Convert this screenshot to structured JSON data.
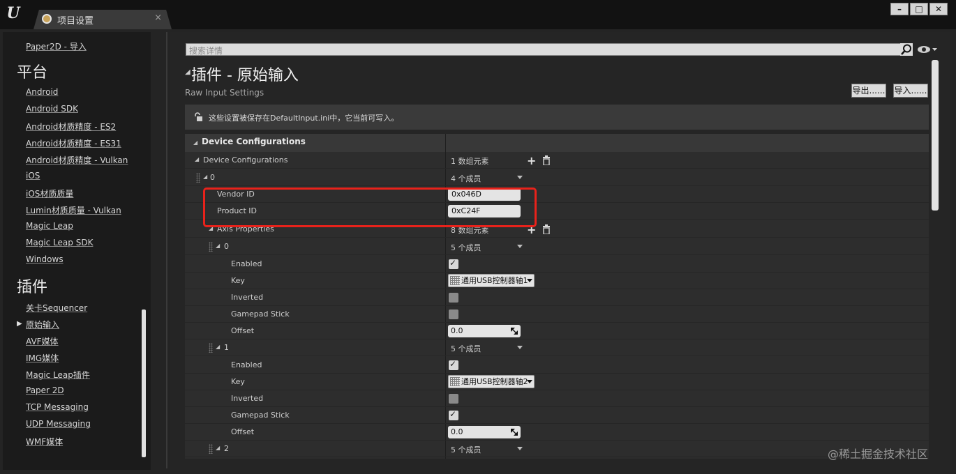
{
  "window": {
    "tab_label": "项目设置",
    "tab_close": "×",
    "logo_text": "U",
    "btn_min": "–",
    "btn_max": "□",
    "btn_close": "✕"
  },
  "sidebar": {
    "top_item": "Paper2D - 导入",
    "platform_heading": "平台",
    "platform_items": [
      "Android",
      "Android SDK",
      "Android材质精度 - ES2",
      "Android材质精度 - ES31",
      "Android材质精度 - Vulkan",
      "iOS",
      "iOS材质质量",
      "Lumin材质质量 - Vulkan",
      "Magic Leap",
      "Magic Leap SDK",
      "Windows"
    ],
    "plugins_heading": "插件",
    "plugin_items": [
      "关卡Sequencer",
      "原始输入",
      "AVF媒体",
      "IMG媒体",
      "Magic Leap插件",
      "Paper 2D",
      "TCP Messaging",
      "UDP Messaging",
      "WMF媒体"
    ],
    "selected_arrow": "▶"
  },
  "main": {
    "search_placeholder": "搜索详情",
    "title": "插件 - 原始输入",
    "title_caret": "◢",
    "subtitle": "Raw Input Settings",
    "export_label": "导出......",
    "import_label": "导入......",
    "notice": "这些设置被保存在DefaultInput.ini中，它当前可写入。",
    "category": "Device Configurations"
  },
  "tree": {
    "device_configurations": {
      "label": "Device Configurations",
      "value": "1 数组元素"
    },
    "device0": {
      "label": "0",
      "value": "4 个成员"
    },
    "vendor_id": {
      "label": "Vendor ID",
      "value": "0x046D"
    },
    "product_id": {
      "label": "Product ID",
      "value": "0xC24F"
    },
    "axis_properties": {
      "label": "Axis Properties",
      "value": "8 数组元素"
    },
    "axes": [
      {
        "index": "0",
        "members": "5 个成员",
        "key": "通用USB控制器轴1",
        "offset": "0.0",
        "enabled": true,
        "inverted": false,
        "gamepad": false
      },
      {
        "index": "1",
        "members": "5 个成员",
        "key": "通用USB控制器轴2",
        "offset": "0.0",
        "enabled": true,
        "inverted": false,
        "gamepad": true
      },
      {
        "index": "2",
        "members": "5 个成员"
      }
    ],
    "field_labels": {
      "enabled": "Enabled",
      "key": "Key",
      "inverted": "Inverted",
      "gamepad": "Gamepad Stick",
      "offset": "Offset"
    },
    "plus": "+",
    "tri_open": "◢",
    "check": "✓"
  },
  "watermark": "@稀土掘金技术社区",
  "colors": {
    "highlight": "#e8221b",
    "background": "#242424",
    "panel": "#2d2d2d"
  }
}
